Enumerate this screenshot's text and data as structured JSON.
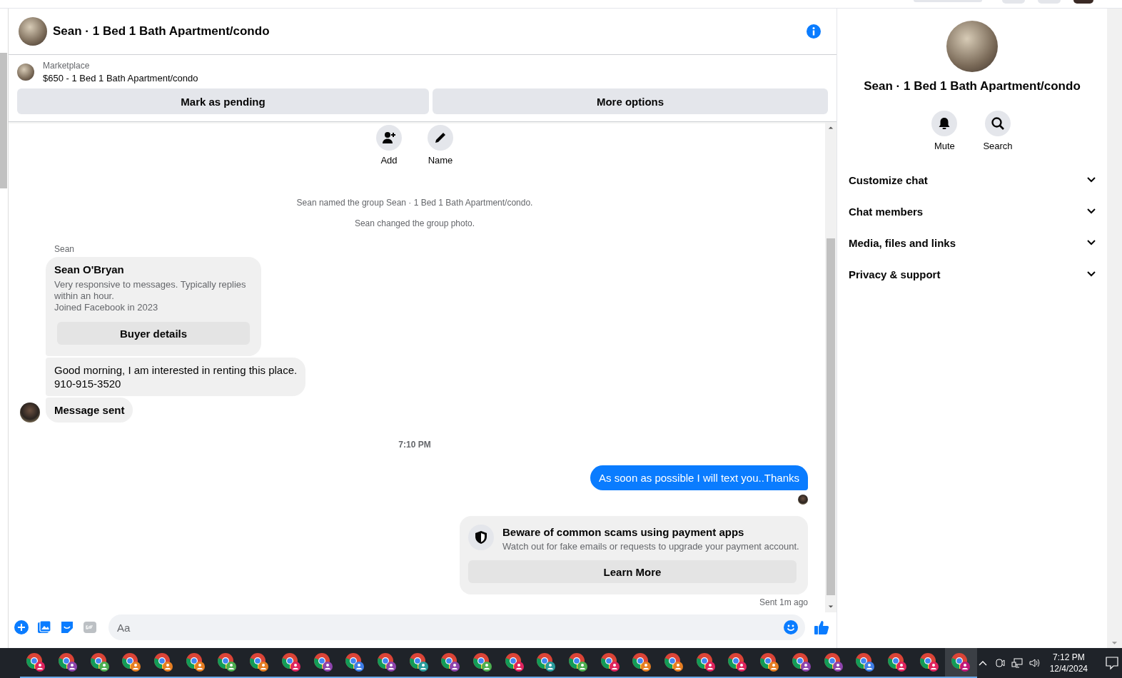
{
  "header": {
    "title": "Sean · 1 Bed 1 Bath Apartment/condo"
  },
  "listing": {
    "source": "Marketplace",
    "title": "$650 - 1 Bed 1 Bath Apartment/condo",
    "actions": [
      "Mark as pending",
      "More options"
    ]
  },
  "group_actions": [
    {
      "label": "Add",
      "kind": "add"
    },
    {
      "label": "Name",
      "kind": "name"
    }
  ],
  "messages": [
    {
      "kind": "system",
      "text": "Sean named the group Sean · 1 Bed 1 Bath Apartment/condo."
    },
    {
      "kind": "system",
      "text": "Sean changed the group photo."
    },
    {
      "kind": "profile",
      "sender": "Sean",
      "name": "Sean O'Bryan",
      "details": "Very responsive to messages. Typically replies within an hour.\nJoined Facebook in 2023",
      "button": "Buyer details"
    },
    {
      "kind": "incoming",
      "text": "Good morning, I am interested in renting this place.\n910-915-3520",
      "bold": false,
      "avatar": false
    },
    {
      "kind": "incoming",
      "text": "Message sent",
      "bold": true,
      "avatar": true
    },
    {
      "kind": "time",
      "text": "7:10 PM"
    },
    {
      "kind": "outgoing",
      "text": "As soon as possible I will text you..Thanks",
      "seen": true
    },
    {
      "kind": "notice",
      "title": "Beware of common scams using payment apps",
      "text": "Watch out for fake emails or requests to upgrade your payment account.",
      "button": "Learn More",
      "status": "Sent 1m ago"
    }
  ],
  "composer": {
    "placeholder": "Aa"
  },
  "panel": {
    "title": "Sean · 1 Bed 1 Bath Apartment/condo",
    "actions": [
      {
        "label": "Mute",
        "kind": "mute"
      },
      {
        "label": "Search",
        "kind": "search"
      }
    ],
    "sections": [
      {
        "label": "Customize chat",
        "expanded": false
      },
      {
        "label": "Chat members",
        "expanded": false
      },
      {
        "label": "Media, files and links",
        "expanded": false
      },
      {
        "label": "Privacy & support",
        "expanded": false
      }
    ]
  },
  "taskbar": {
    "apps": [
      {
        "color": "#e0245e",
        "selected": false
      },
      {
        "color": "#8e44ad",
        "selected": false
      },
      {
        "color": "#4caf50",
        "selected": false
      },
      {
        "color": "#e67e22",
        "selected": false
      },
      {
        "color": "#e67e22",
        "selected": false
      },
      {
        "color": "#e67e22",
        "selected": false
      },
      {
        "color": "#4caf50",
        "selected": false
      },
      {
        "color": "#e67e22",
        "selected": false
      },
      {
        "color": "#e0245e",
        "selected": false
      },
      {
        "color": "#8e44ad",
        "selected": false
      },
      {
        "color": "#3f7ee8",
        "selected": false
      },
      {
        "color": "#8e44ad",
        "selected": false
      },
      {
        "color": "#2a9d9d",
        "selected": false
      },
      {
        "color": "#8e44ad",
        "selected": false
      },
      {
        "color": "#4caf50",
        "selected": false
      },
      {
        "color": "#e0245e",
        "selected": false
      },
      {
        "color": "#2a9d9d",
        "selected": false
      },
      {
        "color": "#4caf50",
        "selected": false
      },
      {
        "color": "#e0245e",
        "selected": false
      },
      {
        "color": "#e67e22",
        "selected": false
      },
      {
        "color": "#e67e22",
        "selected": false
      },
      {
        "color": "#e0245e",
        "selected": false
      },
      {
        "color": "#e0245e",
        "selected": false
      },
      {
        "color": "#e67e22",
        "selected": false
      },
      {
        "color": "#8e44ad",
        "selected": false
      },
      {
        "color": "#8e44ad",
        "selected": false
      },
      {
        "color": "#3f7ee8",
        "selected": false
      },
      {
        "color": "#e0245e",
        "selected": false
      },
      {
        "color": "#e0245e",
        "selected": false
      },
      {
        "color": "#c2187a",
        "selected": true
      }
    ],
    "time": "7:12 PM",
    "date": "12/4/2024"
  }
}
